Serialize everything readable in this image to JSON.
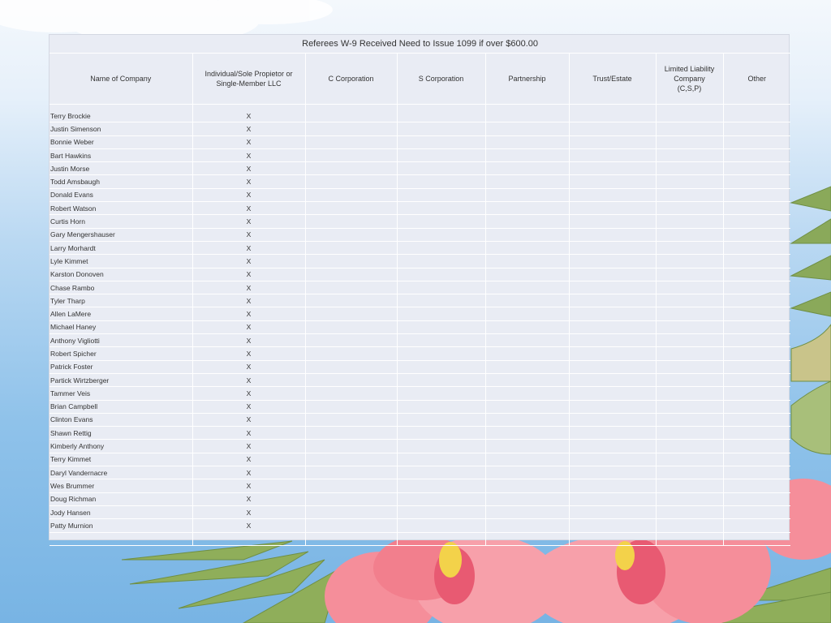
{
  "title": "Referees W-9 Received Need to Issue 1099 if over $600.00",
  "columns": [
    "Name of Company",
    "Individual/Sole Propietor or Single-Member LLC",
    "C Corporation",
    "S Corporation",
    "Partnership",
    "Trust/Estate",
    "Limited Liability Company (C,S,P)",
    "Other"
  ],
  "rows": [
    {
      "name": "Terry Brockie",
      "individual": "X"
    },
    {
      "name": "Justin Simenson",
      "individual": "X"
    },
    {
      "name": "Bonnie Weber",
      "individual": "X"
    },
    {
      "name": "Bart Hawkins",
      "individual": "X"
    },
    {
      "name": "Justin Morse",
      "individual": "X"
    },
    {
      "name": "Todd Amsbaugh",
      "individual": "X"
    },
    {
      "name": "Donald Evans",
      "individual": "X"
    },
    {
      "name": "Robert Watson",
      "individual": "X"
    },
    {
      "name": "Curtis Horn",
      "individual": "X"
    },
    {
      "name": "Gary Mengershauser",
      "individual": "X"
    },
    {
      "name": "Larry Morhardt",
      "individual": "X"
    },
    {
      "name": "Lyle Kimmet",
      "individual": "X"
    },
    {
      "name": "Karston Donoven",
      "individual": "X"
    },
    {
      "name": "Chase Rambo",
      "individual": "X"
    },
    {
      "name": "Tyler Tharp",
      "individual": "X"
    },
    {
      "name": "Allen LaMere",
      "individual": "X"
    },
    {
      "name": "Michael Haney",
      "individual": "X"
    },
    {
      "name": "Anthony Vigliotti",
      "individual": "X"
    },
    {
      "name": "Robert Spicher",
      "individual": "X"
    },
    {
      "name": "Patrick Foster",
      "individual": "X"
    },
    {
      "name": "Partick Wirtzberger",
      "individual": "X"
    },
    {
      "name": "Tammer Veis",
      "individual": "X"
    },
    {
      "name": "Brian Campbell",
      "individual": "X"
    },
    {
      "name": "Clinton Evans",
      "individual": "X"
    },
    {
      "name": "Shawn Rettig",
      "individual": "X"
    },
    {
      "name": "Kimberly Anthony",
      "individual": "X"
    },
    {
      "name": "Terry Kimmet",
      "individual": "X"
    },
    {
      "name": "Daryl Vandernacre",
      "individual": "X"
    },
    {
      "name": "Wes Brummer",
      "individual": "X"
    },
    {
      "name": "Doug Richman",
      "individual": "X"
    },
    {
      "name": "Jody Hansen",
      "individual": "X"
    },
    {
      "name": "Patty Murnion",
      "individual": "X"
    },
    {
      "name": "",
      "individual": ""
    }
  ],
  "colors": {
    "sheet": "#e9ecf4",
    "grid": "#ffffff",
    "text": "#333333",
    "sky": "#8fc2ea",
    "hibiscus": "#f58e9a",
    "palm": "#8fae5a"
  }
}
